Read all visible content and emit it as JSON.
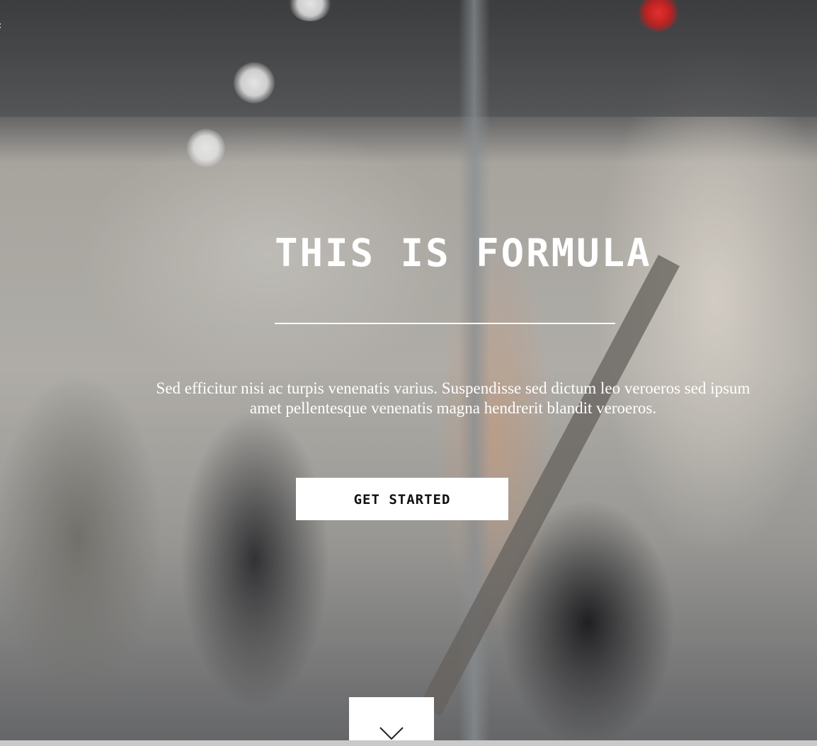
{
  "hero": {
    "title": "THIS IS FORMULA",
    "tagline": "Sed efficitur nisi ac turpis venenatis varius. Suspendisse sed dictum leo veroeros sed ipsum amet pellentesque venenatis magna hendrerit blandit veroeros.",
    "cta_label": "GET STARTED",
    "text_color": "#ffffff",
    "button_color": "#ffffff"
  },
  "icons": {
    "corner": "chevron-icon",
    "scroll": "chevron-down-icon"
  }
}
